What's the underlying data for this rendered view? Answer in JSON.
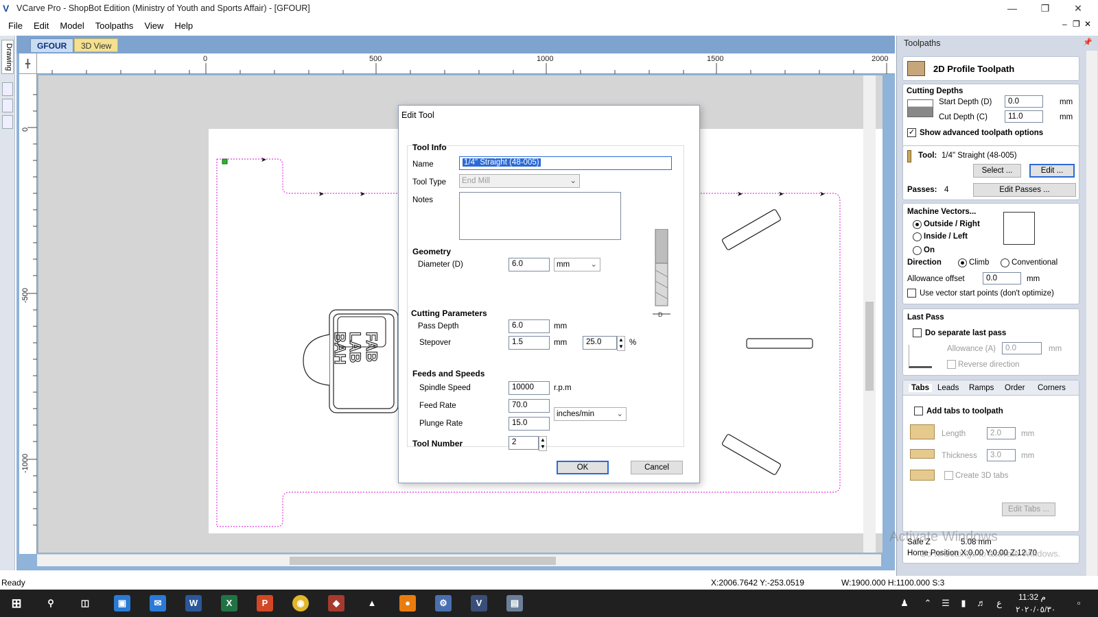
{
  "window": {
    "title": "VCarve Pro - ShopBot Edition (Ministry of Youth and Sports Affair) - [GFOUR]",
    "app_icon": "vcarve-logo-icon"
  },
  "menu": [
    "File",
    "Edit",
    "Model",
    "Toolpaths",
    "View",
    "Help"
  ],
  "left_rail": {
    "tab_label": "Drawing"
  },
  "canvas": {
    "tabs": [
      {
        "label": "GFOUR"
      },
      {
        "label": "3D View"
      }
    ],
    "ruler_h": [
      "0",
      "500",
      "1000",
      "1500",
      "2000"
    ],
    "ruler_v": [
      "0",
      "-500",
      "-1000"
    ],
    "artwork_text": [
      "FAB",
      "LAB",
      "BAH"
    ]
  },
  "dialog": {
    "title": "Edit Tool",
    "tool_info_heading": "Tool Info",
    "name_label": "Name",
    "name_value": "1/4\" Straight  (48-005)",
    "tool_type_label": "Tool Type",
    "tool_type_value": "End Mill",
    "notes_label": "Notes",
    "geometry_heading": "Geometry",
    "diameter_label": "Diameter (D)",
    "diameter_value": "6.0",
    "diameter_units": "mm",
    "cutting_heading": "Cutting Parameters",
    "pass_depth_label": "Pass Depth",
    "pass_depth_value": "6.0",
    "pass_depth_units": "mm",
    "stepover_label": "Stepover",
    "stepover_value": "1.5",
    "stepover_units": "mm",
    "stepover_pct": "25.0",
    "pct_sign": "%",
    "feeds_heading": "Feeds and Speeds",
    "spindle_label": "Spindle Speed",
    "spindle_value": "10000",
    "spindle_units": "r.p.m",
    "feed_label": "Feed Rate",
    "feed_value": "70.0",
    "rate_units": "inches/min",
    "plunge_label": "Plunge Rate",
    "plunge_value": "15.0",
    "tool_number_label": "Tool Number",
    "tool_number_value": "2",
    "ok": "OK",
    "cancel": "Cancel"
  },
  "panel": {
    "header": "Toolpaths",
    "toolpath_title": "2D Profile Toolpath",
    "cutting_depths": "Cutting Depths",
    "start_depth_label": "Start Depth (D)",
    "start_depth_value": "0.0",
    "cut_depth_label": "Cut Depth (C)",
    "cut_depth_value": "11.0",
    "mm": "mm",
    "show_advanced": "Show advanced toolpath options",
    "tool_label": "Tool:",
    "tool_value": "1/4\" Straight  (48-005)",
    "select_btn": "Select ...",
    "edit_btn": "Edit ...",
    "passes_label": "Passes:",
    "passes_value": "4",
    "edit_passes_btn": "Edit Passes ...",
    "machine_vectors": "Machine Vectors...",
    "outside": "Outside / Right",
    "inside": "Inside / Left",
    "on": "On",
    "direction": "Direction",
    "climb": "Climb",
    "conventional": "Conventional",
    "allowance_offset_label": "Allowance offset",
    "allowance_offset_value": "0.0",
    "use_vector_start": "Use vector start points (don't optimize)",
    "last_pass": "Last Pass",
    "do_separate": "Do separate last pass",
    "allowance_a_label": "Allowance (A)",
    "allowance_a_value": "0.0",
    "reverse_direction": "Reverse direction",
    "tabs": [
      "Tabs",
      "Leads",
      "Ramps",
      "Order",
      "Corners"
    ],
    "add_tabs": "Add tabs to toolpath",
    "length_label": "Length",
    "length_value": "2.0",
    "thickness_label": "Thickness",
    "thickness_value": "3.0",
    "create_3d_tabs": "Create 3D tabs",
    "edit_tabs_btn": "Edit Tabs ...",
    "safe_z_label": "Safe Z",
    "safe_z_value": "5.08 mm",
    "home_label": "Home Position",
    "home_value": "X:0.00 Y:0.00 Z:12.70"
  },
  "watermark": {
    "line1": "Activate Windows",
    "line2": "Go to Settings to activate Windows."
  },
  "status": {
    "left": "Ready",
    "coords": "X:2006.7642 Y:-253.0519",
    "size": "W:1900.000  H:1100.000  S:3"
  },
  "taskbar": {
    "time": "11:32 م",
    "date": "٢٠٢٠/٠٥/٣٠",
    "lang": "ع",
    "apps": [
      "windows-start-icon",
      "search-icon",
      "task-view-icon",
      "store-icon",
      "mail-icon",
      "word-icon",
      "excel-icon",
      "powerpoint-icon",
      "chrome-icon",
      "app-icon",
      "app-icon",
      "blender-icon",
      "app-icon",
      "vcarve-icon",
      "app-icon"
    ]
  }
}
